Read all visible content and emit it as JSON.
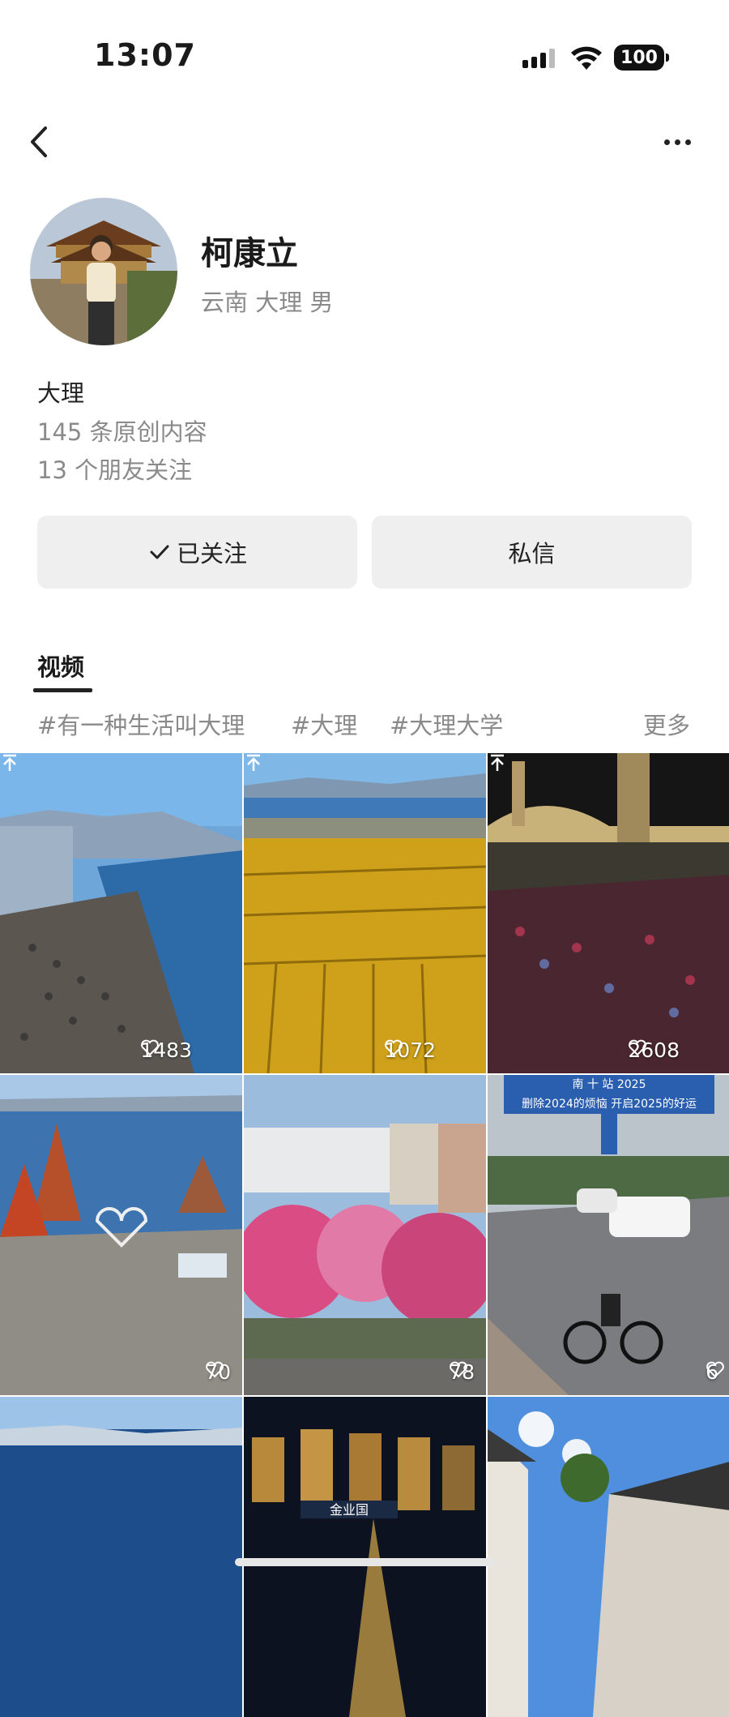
{
  "status": {
    "time": "13:07",
    "battery": "100"
  },
  "profile": {
    "name": "柯康立",
    "meta": "云南 大理 男",
    "bio_title": "大理",
    "content_count": "145 条原创内容",
    "friends_follow": "13 个朋友关注"
  },
  "actions": {
    "follow_label": "已关注",
    "message_label": "私信"
  },
  "tabs": {
    "video": "视频"
  },
  "hashtags": [
    "#有一种生活叫大理",
    "#大理",
    "#大理大学"
  ],
  "more_label": "更多",
  "videos": [
    {
      "likes": "1483",
      "pinned": true
    },
    {
      "likes": "1072",
      "pinned": true
    },
    {
      "likes": "2608",
      "pinned": true
    },
    {
      "likes": "70",
      "pinned": false
    },
    {
      "likes": "78",
      "pinned": false
    },
    {
      "likes": "6",
      "pinned": false
    },
    {
      "likes": "",
      "pinned": false
    },
    {
      "likes": "",
      "pinned": false
    },
    {
      "likes": "",
      "pinned": false
    }
  ],
  "thumb_texts": {
    "sign_line": "删除2024的烦恼 开启2025的好运",
    "sign_top": "南 十 站 2025",
    "night_sign": "金业国"
  },
  "icons": [
    "back-icon",
    "more-icon",
    "check-icon",
    "heart-icon",
    "pin-icon",
    "wifi-icon",
    "signal-icon"
  ]
}
